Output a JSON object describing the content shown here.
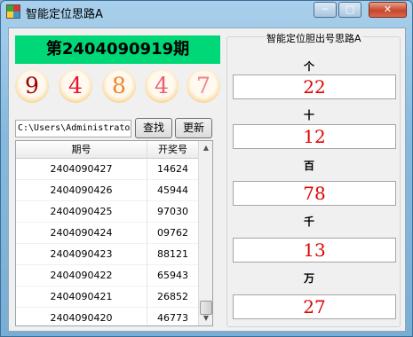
{
  "window": {
    "title": "智能定位思路A",
    "minimize": "─",
    "maximize": "□",
    "close": "✕",
    "icon": "app-icon"
  },
  "issue_banner": "第2404090919期",
  "balls": [
    "9",
    "4",
    "8",
    "4",
    "7"
  ],
  "ball_colors": [
    "#9b0000",
    "#e8142e",
    "#f1822a",
    "#e8606e",
    "#f0808a"
  ],
  "path_field": "C:\\Users\\Administrator",
  "buttons": {
    "search": "查找",
    "refresh": "更新"
  },
  "grid": {
    "headers": [
      "期号",
      "开奖号"
    ],
    "rows": [
      [
        "2404090427",
        "14624"
      ],
      [
        "2404090426",
        "45944"
      ],
      [
        "2404090425",
        "97030"
      ],
      [
        "2404090424",
        "09762"
      ],
      [
        "2404090423",
        "88121"
      ],
      [
        "2404090422",
        "65943"
      ],
      [
        "2404090421",
        "26852"
      ],
      [
        "2404090420",
        "46773"
      ]
    ],
    "scroll_up": "▲",
    "scroll_down": "▼"
  },
  "panel": {
    "title": "智能定位胆出号思路A",
    "positions": [
      {
        "label": "个",
        "value": "22"
      },
      {
        "label": "十",
        "value": "12"
      },
      {
        "label": "百",
        "value": "78"
      },
      {
        "label": "千",
        "value": "13"
      },
      {
        "label": "万",
        "value": "27"
      }
    ]
  }
}
